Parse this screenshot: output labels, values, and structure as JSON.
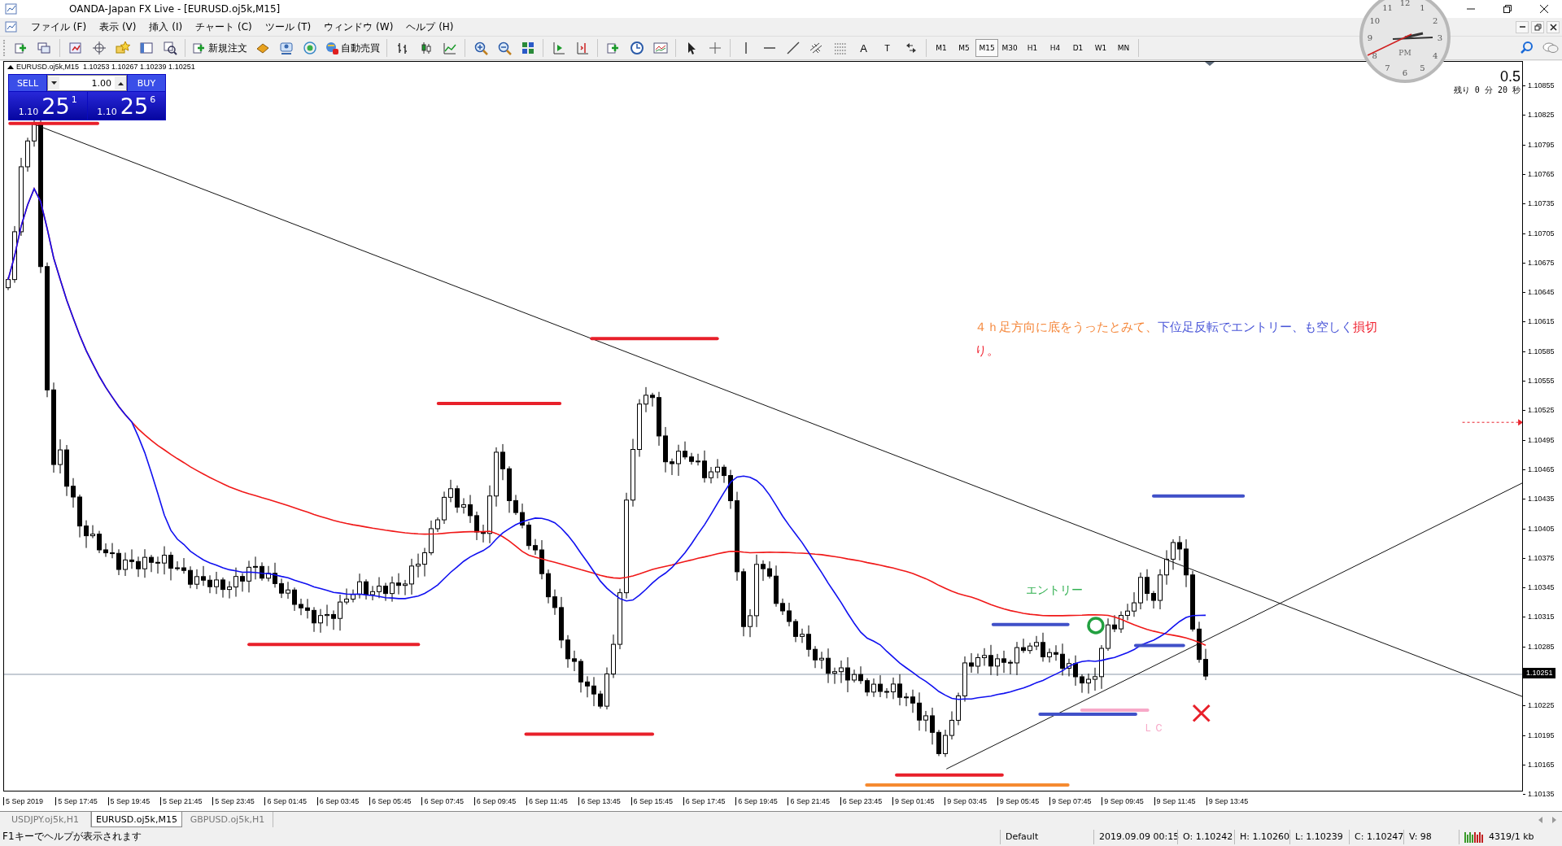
{
  "window": {
    "title": "OANDA-Japan FX Live - [EURUSD.oj5k,M15]"
  },
  "menu": [
    "ファイル (F)",
    "表示 (V)",
    "挿入 (I)",
    "チャート (C)",
    "ツール (T)",
    "ウィンドウ (W)",
    "ヘルプ (H)"
  ],
  "toolbar": {
    "new_order": "新規注文",
    "auto_trading": "自動売買",
    "text_glyphs": [
      "A",
      "T"
    ],
    "timeframes": [
      {
        "label": "M1",
        "selected": false
      },
      {
        "label": "M5",
        "selected": false
      },
      {
        "label": "M15",
        "selected": true
      },
      {
        "label": "M30",
        "selected": false
      },
      {
        "label": "H1",
        "selected": false
      },
      {
        "label": "H4",
        "selected": false
      },
      {
        "label": "D1",
        "selected": false
      },
      {
        "label": "W1",
        "selected": false
      },
      {
        "label": "MN",
        "selected": false
      }
    ]
  },
  "clock": {
    "numerals": [
      "12",
      "1",
      "2",
      "3",
      "4",
      "5",
      "6",
      "7",
      "8",
      "9",
      "10",
      "11"
    ],
    "period": "PM"
  },
  "chart": {
    "header": "EURUSD.oj5k,M15  1.10253 1.10267 1.10239 1.10251",
    "one_click": {
      "sell": "SELL",
      "buy": "BUY",
      "lot": "1.00",
      "sell_price": {
        "prefix": "1.10",
        "pips": "25",
        "fraction": "1"
      },
      "buy_price": {
        "prefix": "1.10",
        "pips": "25",
        "fraction": "6"
      }
    },
    "countdown": {
      "value": "0.5",
      "remaining": "残り 0 分 20 秒"
    },
    "note": [
      {
        "text": "４ｈ足方向に底をうったとみて、",
        "color": "#f5883c"
      },
      {
        "text": "下位足反転でエントリー、も空しく",
        "color": "#4a56d8"
      },
      {
        "text": "損切り。",
        "color": "#f0202e"
      }
    ],
    "entry_label": "エントリー",
    "lc_label": "ＬＣ",
    "price_labels": [
      "1.10855",
      "1.10825",
      "1.10795",
      "1.10765",
      "1.10735",
      "1.10705",
      "1.10675",
      "1.10645",
      "1.10615",
      "1.10585",
      "1.10555",
      "1.10525",
      "1.10495",
      "1.10465",
      "1.10435",
      "1.10405",
      "1.10375",
      "1.10345",
      "1.10315",
      "1.10285",
      "1.10225",
      "1.10195",
      "1.10165",
      "1.10135"
    ],
    "current_price": "1.10251",
    "time_labels": [
      "5 Sep 2019",
      "5 Sep 17:45",
      "5 Sep 19:45",
      "5 Sep 21:45",
      "5 Sep 23:45",
      "6 Sep 01:45",
      "6 Sep 03:45",
      "6 Sep 05:45",
      "6 Sep 07:45",
      "6 Sep 09:45",
      "6 Sep 11:45",
      "6 Sep 13:45",
      "6 Sep 15:45",
      "6 Sep 17:45",
      "6 Sep 19:45",
      "6 Sep 21:45",
      "6 Sep 23:45",
      "9 Sep 01:45",
      "9 Sep 03:45",
      "9 Sep 05:45",
      "9 Sep 07:45",
      "9 Sep 09:45",
      "9 Sep 11:45",
      "9 Sep 13:45"
    ]
  },
  "tabs": [
    {
      "label": "USDJPY.oj5k,H1",
      "selected": false
    },
    {
      "label": "EURUSD.oj5k,M15",
      "selected": true
    },
    {
      "label": "GBPUSD.oj5k,H1",
      "selected": false
    }
  ],
  "status_bar": {
    "help": "F1キーでヘルプが表示されます",
    "profile": "Default",
    "time": "2019.09.09 00:15",
    "open": "O: 1.10242",
    "high": "H: 1.10260",
    "low": "L: 1.10239",
    "close": "C: 1.10247",
    "volume": "V: 98",
    "traffic": "4319/1 kb"
  }
}
